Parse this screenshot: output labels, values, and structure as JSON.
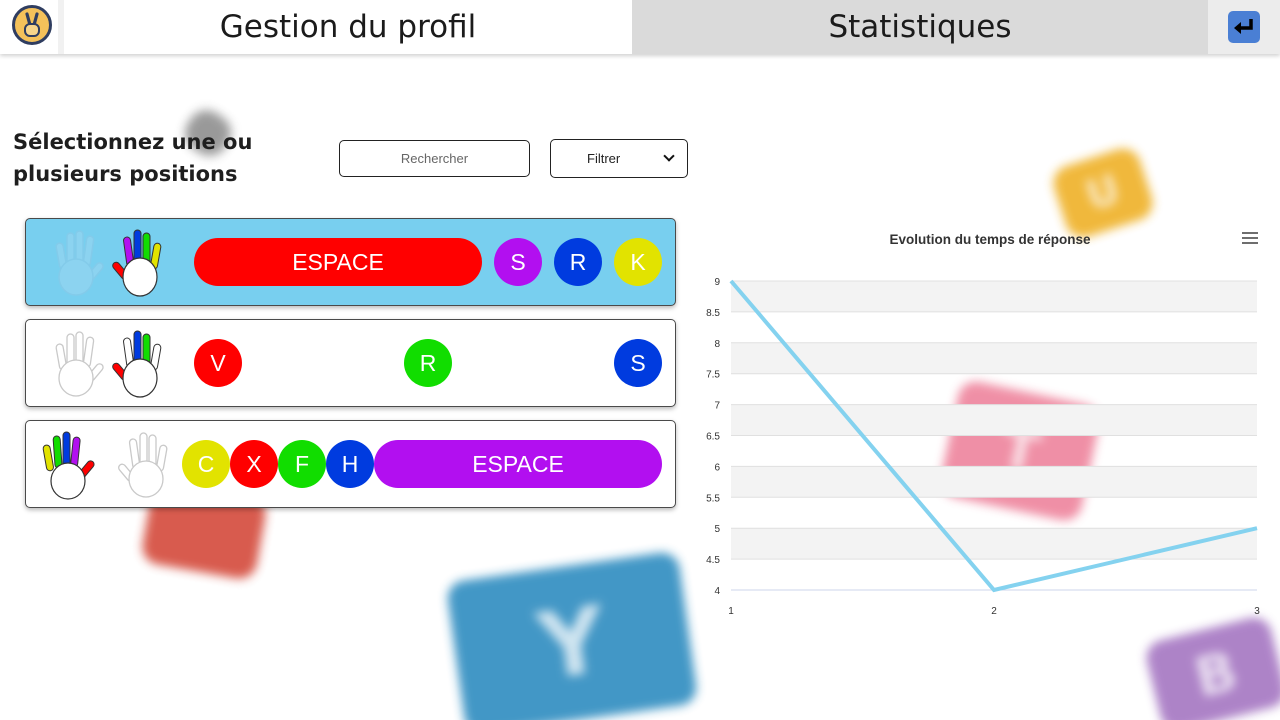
{
  "header": {
    "tabs": [
      {
        "label": "Gestion du profil",
        "active": true
      },
      {
        "label": "Statistiques",
        "active": false
      }
    ],
    "logo_icon": "victory-hand-icon",
    "back_icon": "enter-return-icon"
  },
  "left": {
    "prompt": "Sélectionnez une ou plusieurs positions",
    "search_placeholder": "Rechercher",
    "filter_label": "Filtrer",
    "positions": [
      {
        "selected": true,
        "left_hand": "colored",
        "right_hand": "colored",
        "keys": [
          {
            "label": "ESPACE",
            "color": "#ff0000",
            "shape": "pill"
          },
          {
            "label": "S",
            "color": "#b20ff0",
            "shape": "round"
          },
          {
            "label": "R",
            "color": "#003bdf",
            "shape": "round"
          },
          {
            "label": "K",
            "color": "#e2e300",
            "shape": "round"
          }
        ]
      },
      {
        "selected": false,
        "left_hand": "outline",
        "right_hand": "colored",
        "keys": [
          {
            "label": "V",
            "color": "#ff0000",
            "shape": "round"
          },
          {
            "label": "R",
            "color": "#11dd00",
            "shape": "round"
          },
          {
            "label": "S",
            "color": "#003bdf",
            "shape": "round"
          }
        ]
      },
      {
        "selected": false,
        "left_hand": "colored",
        "right_hand": "outline",
        "keys": [
          {
            "label": "C",
            "color": "#e2e300",
            "shape": "round"
          },
          {
            "label": "X",
            "color": "#ff0000",
            "shape": "round"
          },
          {
            "label": "F",
            "color": "#11dd00",
            "shape": "round"
          },
          {
            "label": "H",
            "color": "#003bdf",
            "shape": "round"
          },
          {
            "label": "ESPACE",
            "color": "#b20ff0",
            "shape": "pill"
          }
        ]
      }
    ]
  },
  "colors": {
    "selected_card": "#78cfef",
    "line": "#84d2ef",
    "back_button": "#4a7fd4"
  },
  "chart_data": {
    "type": "line",
    "title": "Evolution du temps de réponse",
    "x": [
      1,
      2,
      3
    ],
    "series": [
      {
        "values": [
          9,
          4,
          5
        ]
      }
    ],
    "xlim": [
      1,
      3
    ],
    "ylim": [
      4,
      9
    ],
    "yticks": [
      "4",
      "4.5",
      "5",
      "5.5",
      "6",
      "6.5",
      "7",
      "7.5",
      "8",
      "8.5",
      "9"
    ],
    "xticks": [
      "1",
      "2",
      "3"
    ],
    "grid": true,
    "legend": "none"
  }
}
